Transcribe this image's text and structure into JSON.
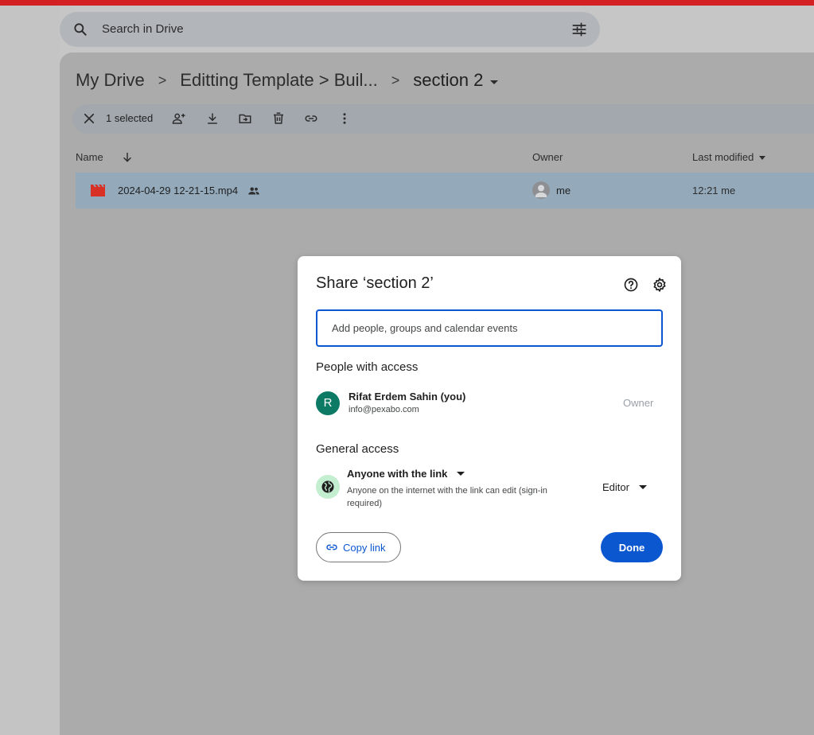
{
  "search": {
    "placeholder": "Search in Drive"
  },
  "breadcrumb": {
    "items": [
      "My Drive",
      "Editting Template > Buil...",
      "section 2"
    ],
    "separator": ">"
  },
  "selection_bar": {
    "count_label": "1 selected"
  },
  "table": {
    "columns": [
      "Name",
      "Owner",
      "Last modified"
    ],
    "rows": [
      {
        "name": "2024-04-29 12-21-15.mp4",
        "owner": "me",
        "modified": "12:21 me"
      }
    ]
  },
  "share_dialog": {
    "title": "Share ‘section 2’",
    "input_placeholder": "Add people, groups and calendar events",
    "people_heading": "People with access",
    "person": {
      "initial": "R",
      "name": "Rifat Erdem Sahin (you)",
      "email": "info@pexabo.com",
      "role": "Owner"
    },
    "general_heading": "General access",
    "access": {
      "label": "Anyone with the link",
      "description": "Anyone on the internet with the link can edit (sign-in required)",
      "role": "Editor"
    },
    "copy_link_label": "Copy link",
    "done_label": "Done"
  },
  "colors": {
    "accent": "#0b57d0",
    "top_strip": "#d32023",
    "avatar": "#0d7a66",
    "globe_bg": "#c4eed0",
    "video_icon": "#d93025"
  }
}
